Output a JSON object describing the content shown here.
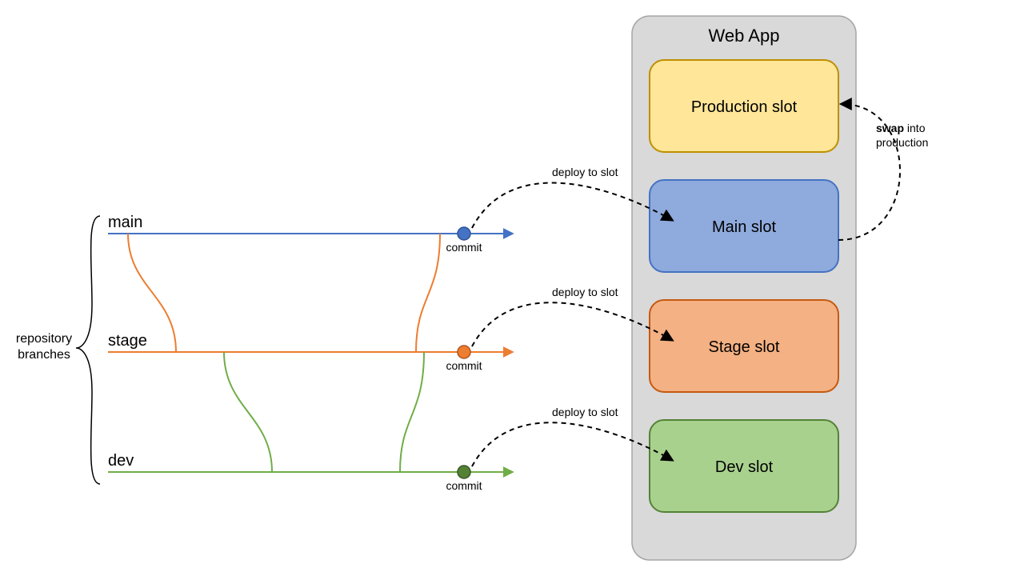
{
  "title": "Web App",
  "side_label_line1": "repository",
  "side_label_line2": "branches",
  "branches": {
    "main": {
      "label": "main",
      "commit": "commit",
      "deploy": "deploy to slot",
      "color": "#4472C4"
    },
    "stage": {
      "label": "stage",
      "commit": "commit",
      "deploy": "deploy to slot",
      "color": "#ED7D31"
    },
    "dev": {
      "label": "dev",
      "commit": "commit",
      "deploy": "deploy to slot",
      "color": "#70AD47"
    }
  },
  "slots": {
    "production": {
      "label": "Production slot",
      "fill": "#FFE699",
      "stroke": "#BF8F00"
    },
    "main": {
      "label": "Main slot",
      "fill": "#8FAADC",
      "stroke": "#4472C4"
    },
    "stage": {
      "label": "Stage slot",
      "fill": "#F4B183",
      "stroke": "#C55A11"
    },
    "dev": {
      "label": "Dev slot",
      "fill": "#A9D18E",
      "stroke": "#548235"
    }
  },
  "swap_bold": "swap",
  "swap_rest": " into",
  "swap_line2": "production",
  "colors": {
    "container_fill": "#D9D9D9",
    "container_stroke": "#A6A6A6",
    "dash": "#000000"
  }
}
